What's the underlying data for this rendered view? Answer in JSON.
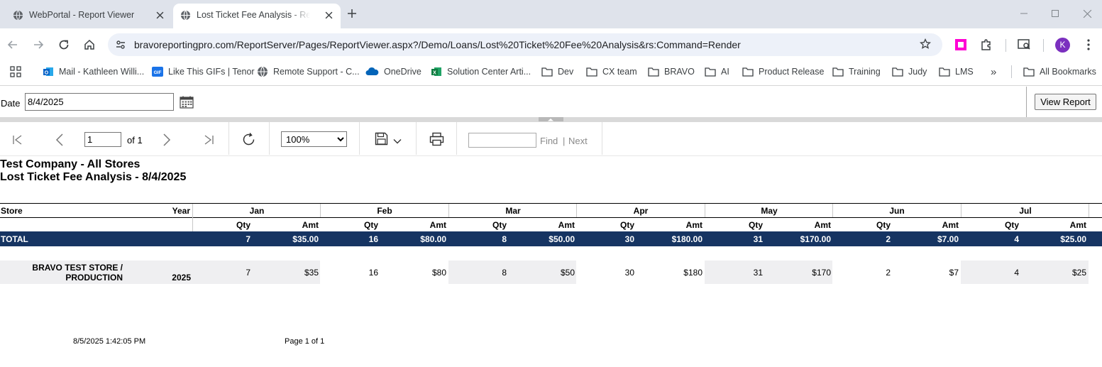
{
  "browser": {
    "tabs": [
      {
        "title": "WebPortal - Report Viewer",
        "active": false
      },
      {
        "title": "Lost Ticket Fee Analysis - Report Viewer",
        "active": true
      }
    ],
    "url": "bravoreportingpro.com/ReportServer/Pages/ReportViewer.aspx?/Demo/Loans/Lost%20Ticket%20Fee%20Analysis&rs:Command=Render",
    "profile_initial": "K",
    "accent_color": "#7b2fbf",
    "bookmarks": [
      {
        "label": "Mail - Kathleen Willi...",
        "icon": "outlook-icon"
      },
      {
        "label": "Like This GIFs | Tenor",
        "icon": "gif-icon"
      },
      {
        "label": "Remote Support - C...",
        "icon": "globe-icon"
      },
      {
        "label": "OneDrive",
        "icon": "cloud-icon"
      },
      {
        "label": "Solution Center Arti...",
        "icon": "excel-icon"
      },
      {
        "label": "Dev",
        "icon": "folder-icon"
      },
      {
        "label": "CX team",
        "icon": "folder-icon"
      },
      {
        "label": "BRAVO",
        "icon": "folder-icon"
      },
      {
        "label": "AI",
        "icon": "folder-icon"
      },
      {
        "label": "Product Release",
        "icon": "folder-icon"
      },
      {
        "label": "Training",
        "icon": "folder-icon"
      },
      {
        "label": "Judy",
        "icon": "folder-icon"
      },
      {
        "label": "LMS",
        "icon": "folder-icon"
      }
    ],
    "overflow_label": "»",
    "all_bookmarks_label": "All Bookmarks"
  },
  "params": {
    "date_label": "Date",
    "date_value": "8/4/2025",
    "view_report_label": "View Report"
  },
  "toolbar": {
    "page_value": "1",
    "of_label": "of 1",
    "zoom_value": "100%",
    "zoom_options": [
      "100%"
    ],
    "find_label": "Find",
    "separator": "|",
    "next_label": "Next"
  },
  "report": {
    "company": "Test Company - All Stores",
    "title": "Lost Ticket Fee Analysis - 8/4/2025",
    "store_header": "Store",
    "year_header": "Year",
    "qty_header": "Qty",
    "amt_header": "Amt",
    "months": [
      "Jan",
      "Feb",
      "Mar",
      "Apr",
      "May",
      "Jun",
      "Jul"
    ],
    "total": {
      "label": "TOTAL",
      "qty": [
        "7",
        "16",
        "8",
        "30",
        "31",
        "2",
        "4"
      ],
      "amt": [
        "$35.00",
        "$80.00",
        "$50.00",
        "$180.00",
        "$170.00",
        "$7.00",
        "$25.00"
      ]
    },
    "rows": [
      {
        "store_line1": "BRAVO TEST STORE /",
        "store_line2": "PRODUCTION",
        "year": "2025",
        "qty": [
          "7",
          "16",
          "8",
          "30",
          "31",
          "2",
          "4"
        ],
        "amt": [
          "$35",
          "$80",
          "$50",
          "$180",
          "$170",
          "$7",
          "$25"
        ]
      }
    ],
    "footer_timestamp": "8/5/2025 1:42:05 PM",
    "footer_page": "Page 1 of 1"
  }
}
